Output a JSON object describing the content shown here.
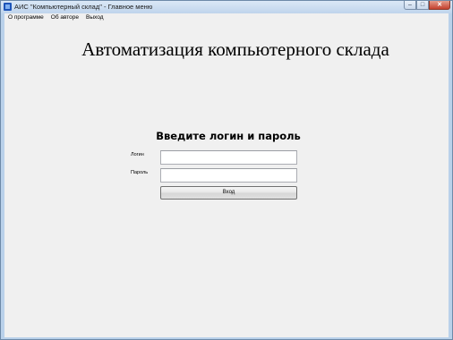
{
  "window": {
    "title": "АИС \"Компьютерный склад\" - Главное меню",
    "icon": "app-icon",
    "controls": {
      "minimize_glyph": "–",
      "maximize_glyph": "□",
      "close_glyph": "✕"
    }
  },
  "menu": {
    "items": [
      "О программе",
      "Об авторе",
      "Выход"
    ]
  },
  "main": {
    "heading": "Автоматизация компьютерного склада"
  },
  "login_form": {
    "heading": "Введите логин и пароль",
    "login_label": "Логин",
    "login_value": "",
    "password_label": "Пароль",
    "password_value": "",
    "submit_label": "Вход"
  }
}
